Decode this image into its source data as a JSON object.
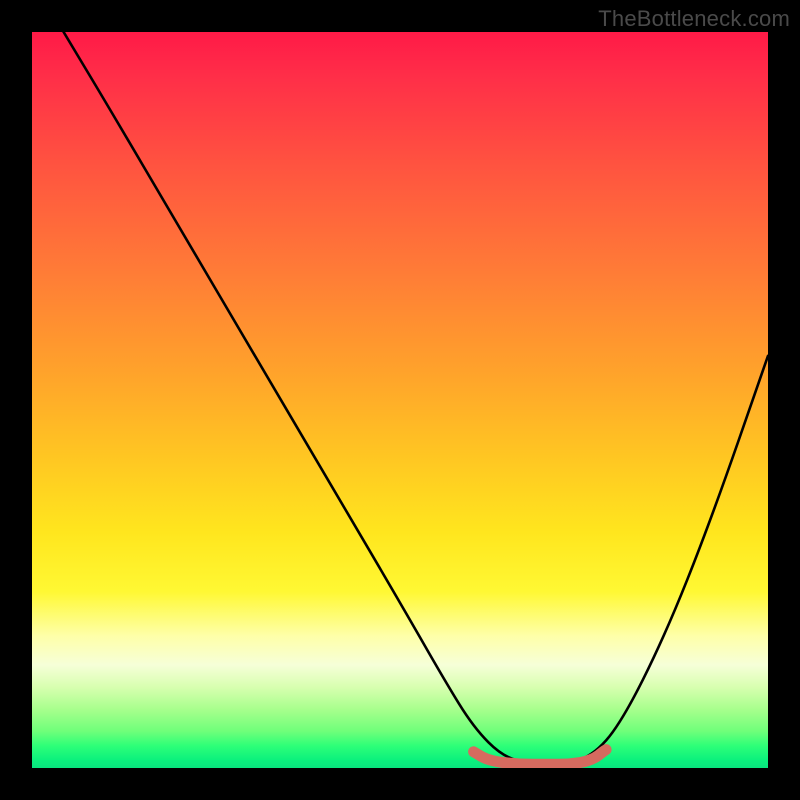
{
  "watermark": "TheBottleneck.com",
  "chart_data": {
    "type": "line",
    "title": "",
    "xlabel": "",
    "ylabel": "",
    "xlim": [
      0,
      100
    ],
    "ylim": [
      0,
      100
    ],
    "grid": false,
    "legend": false,
    "series": [
      {
        "name": "curve",
        "color": "#000000",
        "x": [
          4.3,
          10,
          20,
          30,
          40,
          50,
          56,
          60,
          64,
          68,
          72,
          76,
          80,
          86,
          92,
          100
        ],
        "y": [
          100,
          90.5,
          73.5,
          56.5,
          39.5,
          22.5,
          12,
          5.5,
          1.5,
          0.5,
          0.5,
          1.5,
          6,
          18,
          33,
          56
        ]
      },
      {
        "name": "floor-dash",
        "color": "#d66a5f",
        "x": [
          60,
          62,
          66,
          70,
          73,
          76,
          78
        ],
        "y": [
          2.2,
          1.0,
          0.5,
          0.5,
          0.5,
          1.0,
          2.5
        ]
      }
    ],
    "background_gradient": {
      "top": "#ff1a47",
      "mid": "#ffe61e",
      "bottom": "#09e47e"
    }
  }
}
